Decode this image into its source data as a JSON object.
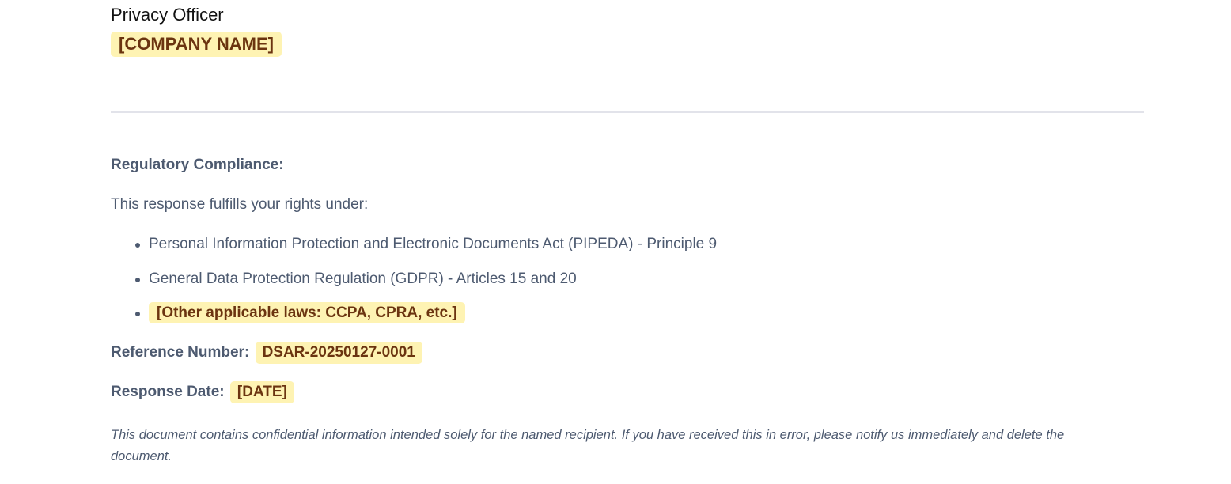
{
  "signature": {
    "title": "Privacy Officer",
    "company_placeholder": "[COMPANY NAME]"
  },
  "compliance": {
    "heading": "Regulatory Compliance:",
    "intro": "This response fulfills your rights under:",
    "laws": [
      "Personal Information Protection and Electronic Documents Act (PIPEDA) - Principle 9",
      "General Data Protection Regulation (GDPR) - Articles 15 and 20",
      "[Other applicable laws: CCPA, CPRA, etc.]"
    ]
  },
  "reference": {
    "label": "Reference Number:",
    "value": "DSAR-20250127-0001"
  },
  "response_date": {
    "label": "Response Date:",
    "value": "[DATE]"
  },
  "disclaimer": "This document contains confidential information intended solely for the named recipient. If you have received this in error, please notify us immediately and delete the document.",
  "colors": {
    "highlight_background": "#fef3b3",
    "highlight_text": "#6b3410",
    "body_text": "#4d5a70",
    "divider": "#e2e3ea"
  }
}
